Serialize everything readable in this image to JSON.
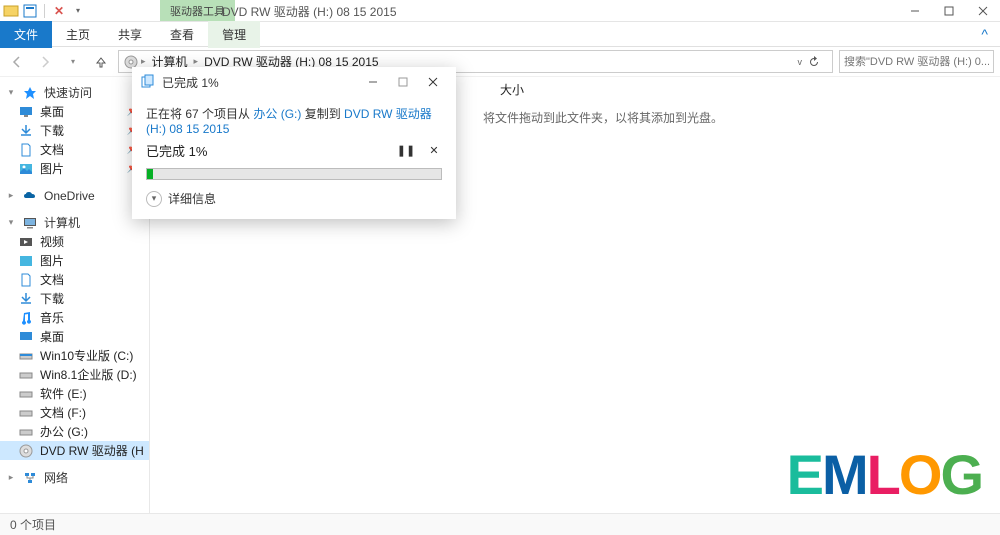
{
  "window": {
    "contextual_tab_group": "驱动器工具",
    "title": "DVD RW 驱动器 (H:) 08 15 2015"
  },
  "ribbon": {
    "file": "文件",
    "tabs": [
      "主页",
      "共享",
      "查看",
      "管理"
    ]
  },
  "breadcrumbs": {
    "items": [
      "计算机",
      "DVD RW 驱动器 (H:) 08 15 2015"
    ]
  },
  "search": {
    "placeholder": "搜索\"DVD RW 驱动器 (H:) 0..."
  },
  "sidebar": {
    "quick_access": {
      "label": "快速访问",
      "items": [
        {
          "label": "桌面",
          "icon": "desktop",
          "pinned": true
        },
        {
          "label": "下载",
          "icon": "download",
          "pinned": true
        },
        {
          "label": "文档",
          "icon": "document",
          "pinned": true
        },
        {
          "label": "图片",
          "icon": "picture",
          "pinned": true
        }
      ]
    },
    "onedrive": {
      "label": "OneDrive"
    },
    "this_pc": {
      "label": "计算机",
      "items": [
        {
          "label": "视频",
          "icon": "video"
        },
        {
          "label": "图片",
          "icon": "picture"
        },
        {
          "label": "文档",
          "icon": "document"
        },
        {
          "label": "下载",
          "icon": "download"
        },
        {
          "label": "音乐",
          "icon": "music"
        },
        {
          "label": "桌面",
          "icon": "desktop"
        },
        {
          "label": "Win10专业版 (C:)",
          "icon": "drive"
        },
        {
          "label": "Win8.1企业版 (D:)",
          "icon": "drive"
        },
        {
          "label": "软件 (E:)",
          "icon": "drive"
        },
        {
          "label": "文档 (F:)",
          "icon": "drive"
        },
        {
          "label": "办公 (G:)",
          "icon": "drive"
        },
        {
          "label": "DVD RW 驱动器 (H",
          "icon": "disc",
          "active": true
        }
      ]
    },
    "network": {
      "label": "网络"
    }
  },
  "content": {
    "column_size": "大小",
    "empty_hint": "将文件拖动到此文件夹，以将其添加到光盘。"
  },
  "statusbar": {
    "items_count": "0 个项目"
  },
  "progress_dialog": {
    "title": "已完成 1%",
    "copying_prefix": "正在将 67 个项目从 ",
    "copying_source": "办公 (G:)",
    "copying_middle": " 复制到 ",
    "copying_dest": "DVD RW 驱动器 (H:) 08 15 2015",
    "progress_label": "已完成 1%",
    "progress_percent": 1,
    "details_label": "详细信息"
  },
  "watermark": {
    "text": "EMLOG"
  }
}
